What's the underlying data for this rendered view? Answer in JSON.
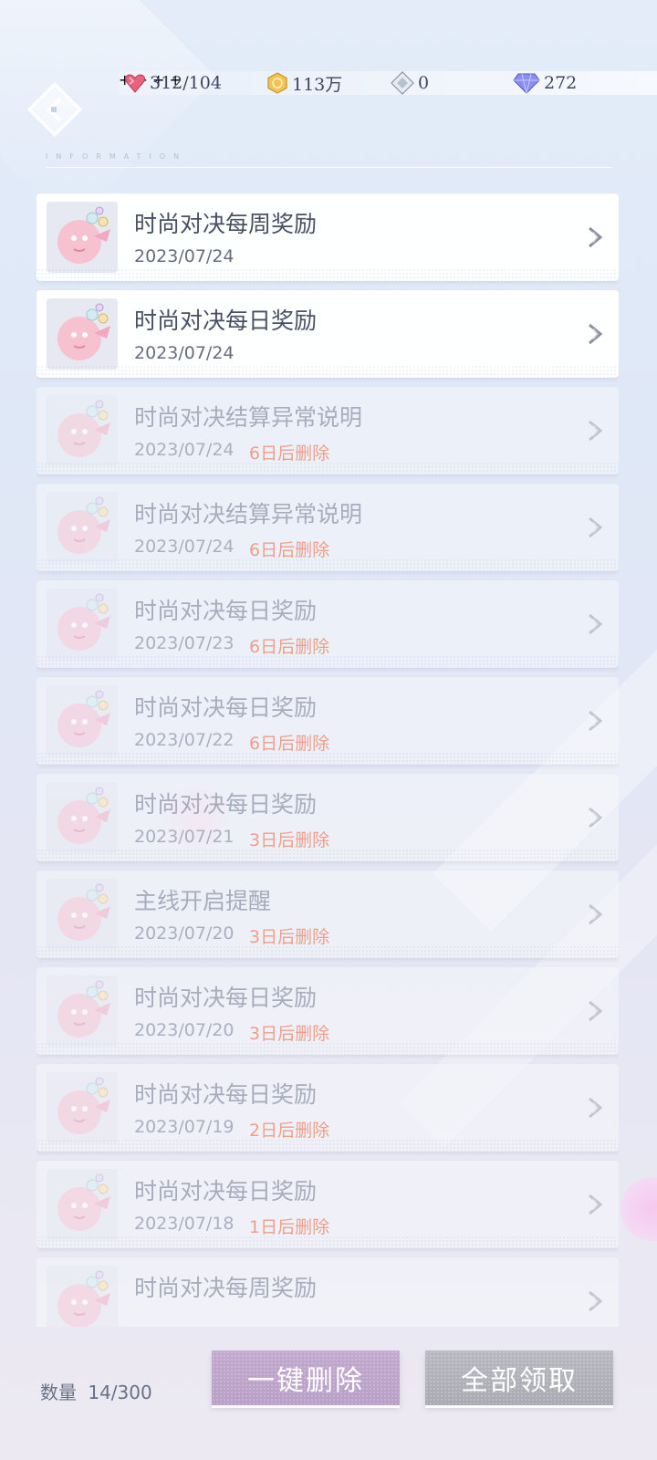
{
  "header": {
    "back_icon": "back-arrow-icon",
    "info_label": "INFORMATION"
  },
  "resources": [
    {
      "icon": "pink-heart-gem-icon",
      "value": "312/104",
      "plus": "+"
    },
    {
      "icon": "gold-coin-icon",
      "value": "113万",
      "plus": "+"
    },
    {
      "icon": "silver-diamond-icon",
      "value": "0",
      "plus": "+"
    },
    {
      "icon": "blue-diamond-icon",
      "value": "272",
      "plus": "+"
    }
  ],
  "mails": [
    {
      "title": "时尚对决每周奖励",
      "date": "2023/07/24",
      "expire": "",
      "read": false
    },
    {
      "title": "时尚对决每日奖励",
      "date": "2023/07/24",
      "expire": "",
      "read": false
    },
    {
      "title": "时尚对决结算异常说明",
      "date": "2023/07/24",
      "expire": "6日后删除",
      "read": true
    },
    {
      "title": "时尚对决结算异常说明",
      "date": "2023/07/24",
      "expire": "6日后删除",
      "read": true
    },
    {
      "title": "时尚对决每日奖励",
      "date": "2023/07/23",
      "expire": "6日后删除",
      "read": true
    },
    {
      "title": "时尚对决每日奖励",
      "date": "2023/07/22",
      "expire": "6日后删除",
      "read": true
    },
    {
      "title": "时尚对决每日奖励",
      "date": "2023/07/21",
      "expire": "3日后删除",
      "read": true
    },
    {
      "title": "主线开启提醒",
      "date": "2023/07/20",
      "expire": "3日后删除",
      "read": true
    },
    {
      "title": "时尚对决每日奖励",
      "date": "2023/07/20",
      "expire": "3日后删除",
      "read": true
    },
    {
      "title": "时尚对决每日奖励",
      "date": "2023/07/19",
      "expire": "2日后删除",
      "read": true
    },
    {
      "title": "时尚对决每日奖励",
      "date": "2023/07/18",
      "expire": "1日后删除",
      "read": true
    },
    {
      "title": "时尚对决每周奖励",
      "date": "",
      "expire": "",
      "read": true
    }
  ],
  "footer": {
    "count_label": "数量",
    "count_value": "14/300",
    "delete_all": "一键删除",
    "claim_all": "全部领取"
  }
}
